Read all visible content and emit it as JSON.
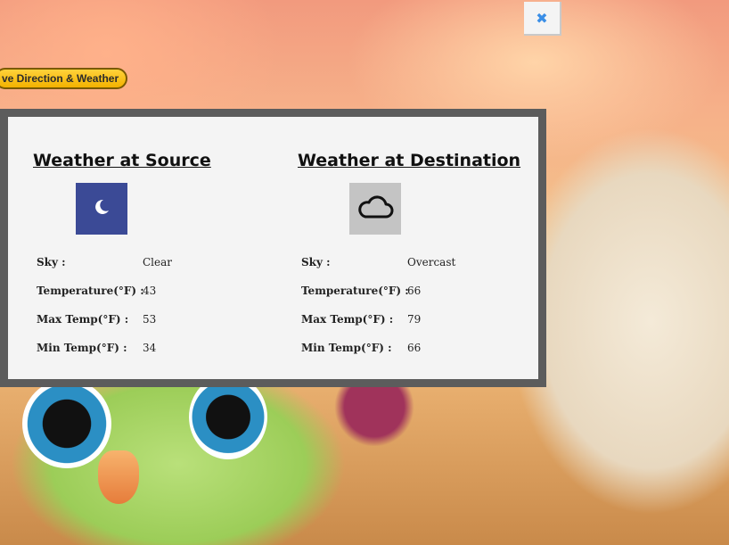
{
  "nav": {
    "direction_weather_label": "ve Direction & Weather"
  },
  "close_button": {
    "label": "✖"
  },
  "source": {
    "title": "Weather at Source",
    "icon": "moon-icon",
    "rows": [
      {
        "label": "Sky :",
        "value": "Clear"
      },
      {
        "label": "Temperature(°F) :",
        "value": "43"
      },
      {
        "label": "Max Temp(°F) :",
        "value": "53"
      },
      {
        "label": "Min Temp(°F) :",
        "value": "34"
      }
    ]
  },
  "destination": {
    "title": "Weather at Destination",
    "icon": "cloud-icon",
    "rows": [
      {
        "label": "Sky :",
        "value": "Overcast"
      },
      {
        "label": "Temperature(°F) :",
        "value": "66"
      },
      {
        "label": "Max Temp(°F) :",
        "value": "79"
      },
      {
        "label": "Min Temp(°F) :",
        "value": "66"
      }
    ]
  },
  "colors": {
    "panel_border": "#5c5c5c",
    "panel_bg": "#f4f4f4",
    "source_icon_bg": "#3b4a96",
    "destination_icon_bg": "#c4c4c4",
    "nav_pill": "#f3b200",
    "close_icon": "#3a8ee6"
  }
}
